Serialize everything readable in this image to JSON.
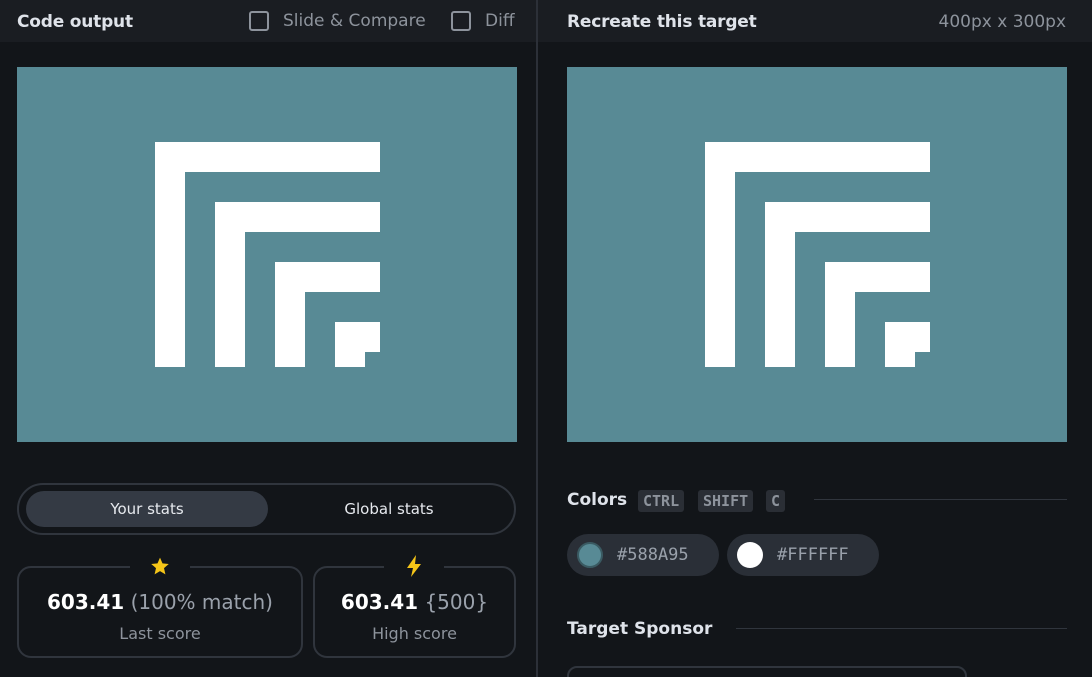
{
  "left_panel": {
    "title": "Code output",
    "options": [
      {
        "label": "Slide & Compare",
        "checked": false
      },
      {
        "label": "Diff",
        "checked": false
      }
    ]
  },
  "right_panel": {
    "title": "Recreate this target",
    "dimensions": "400px x 300px"
  },
  "stats_tabs": {
    "active": "Your stats",
    "inactive": "Global stats"
  },
  "last_score": {
    "icon": "star-icon",
    "value": "603.41",
    "match": "(100% match)",
    "label": "Last score"
  },
  "high_score": {
    "icon": "lightning-icon",
    "value": "603.41",
    "chars": "{500}",
    "label": "High score"
  },
  "colors_section": {
    "title": "Colors",
    "shortcut": [
      "CTRL",
      "SHIFT",
      "C"
    ],
    "swatches": [
      {
        "hex": "#588A95"
      },
      {
        "hex": "#FFFFFF"
      }
    ]
  },
  "sponsor_section": {
    "title": "Target Sponsor"
  },
  "colors": {
    "background": "#588A95",
    "foreground": "#FFFFFF",
    "star": "#f5c518"
  }
}
